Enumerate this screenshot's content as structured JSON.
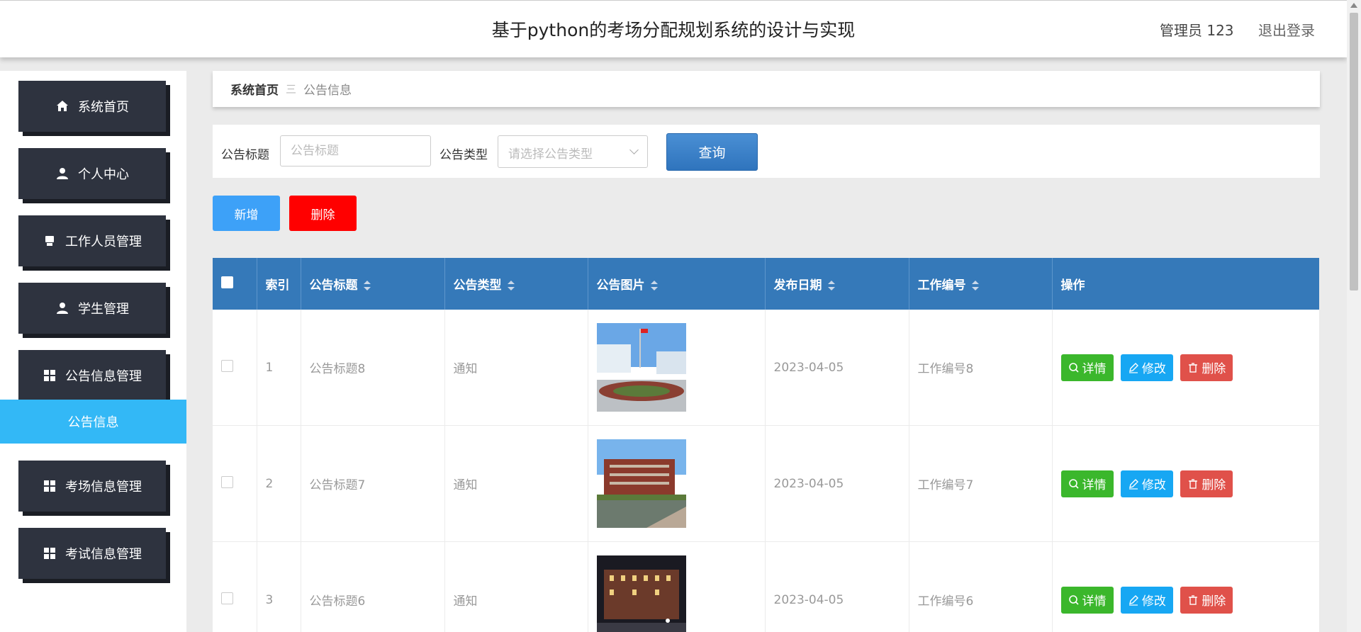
{
  "header": {
    "title": "基于python的考场分配规划系统的设计与实现",
    "user": "管理员 123",
    "logout": "退出登录"
  },
  "sidebar": {
    "items": [
      {
        "label": "系统首页",
        "icon": "home-icon"
      },
      {
        "label": "个人中心",
        "icon": "user-icon"
      },
      {
        "label": "工作人员管理",
        "icon": "staff-icon"
      },
      {
        "label": "学生管理",
        "icon": "user-icon"
      },
      {
        "label": "公告信息管理",
        "icon": "grid-icon"
      },
      {
        "label": "考场信息管理",
        "icon": "grid-icon"
      },
      {
        "label": "考试信息管理",
        "icon": "grid-icon"
      }
    ],
    "active_sub": "公告信息"
  },
  "breadcrumb": {
    "home": "系统首页",
    "separator": "三",
    "current": "公告信息"
  },
  "search": {
    "title_label": "公告标题",
    "title_placeholder": "公告标题",
    "type_label": "公告类型",
    "type_placeholder": "请选择公告类型",
    "query_button": "查询"
  },
  "actions": {
    "add": "新增",
    "delete": "删除"
  },
  "table": {
    "headers": [
      "索引",
      "公告标题",
      "公告类型",
      "公告图片",
      "发布日期",
      "工作编号",
      "操作"
    ],
    "rows": [
      {
        "index": "1",
        "title": "公告标题8",
        "type": "通知",
        "date": "2023-04-05",
        "work_no": "工作编号8"
      },
      {
        "index": "2",
        "title": "公告标题7",
        "type": "通知",
        "date": "2023-04-05",
        "work_no": "工作编号7"
      },
      {
        "index": "3",
        "title": "公告标题6",
        "type": "通知",
        "date": "2023-04-05",
        "work_no": "工作编号6"
      }
    ],
    "row_actions": {
      "detail": "详情",
      "edit": "修改",
      "delete": "删除"
    }
  },
  "colors": {
    "header_blue": "#3579b9",
    "sidebar_dark": "#2e333f",
    "submenu_active": "#33b8f6",
    "detail_green": "#3bb72c",
    "edit_blue": "#17a7f3",
    "delete_red": "#e0514a"
  }
}
